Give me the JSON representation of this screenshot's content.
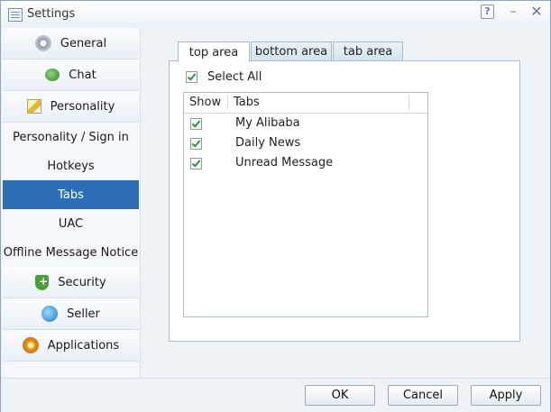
{
  "window": {
    "title": "Settings",
    "help_label": "?",
    "minimize_label": "–",
    "close_label": "✕"
  },
  "sidebar": {
    "items": [
      {
        "label": "General",
        "icon": "gear-icon"
      },
      {
        "label": "Chat",
        "icon": "chat-icon"
      },
      {
        "label": "Personality",
        "icon": "pencil-icon"
      },
      {
        "label": "Personality / Sign in"
      },
      {
        "label": "Hotkeys"
      },
      {
        "label": "Tabs",
        "selected": true
      },
      {
        "label": "UAC"
      },
      {
        "label": "Offline Message Notice"
      },
      {
        "label": "Security",
        "icon": "shield-icon"
      },
      {
        "label": "Seller",
        "icon": "seller-icon"
      },
      {
        "label": "Applications",
        "icon": "applications-icon"
      }
    ]
  },
  "tabs": {
    "items": [
      {
        "label": "top area",
        "active": true
      },
      {
        "label": "bottom area"
      },
      {
        "label": "tab area"
      }
    ]
  },
  "panel": {
    "select_all_label": "Select All",
    "select_all_checked": true,
    "columns": {
      "show": "Show",
      "tabs": "Tabs"
    },
    "rows": [
      {
        "label": "My Alibaba",
        "checked": true
      },
      {
        "label": "Daily News",
        "checked": true
      },
      {
        "label": "Unread Message",
        "checked": true
      }
    ]
  },
  "footer": {
    "ok_label": "OK",
    "cancel_label": "Cancel",
    "apply_label": "Apply"
  },
  "colors": {
    "selected_item": "#2d6fb4",
    "check": "#2a9a2a",
    "border": "#aebcc9"
  }
}
